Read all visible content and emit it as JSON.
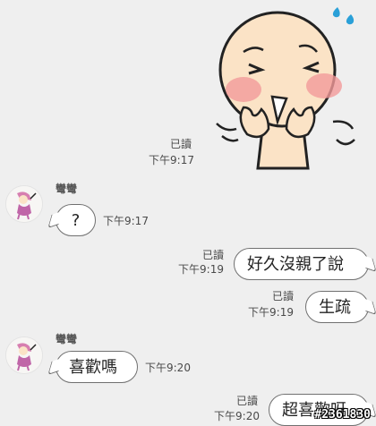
{
  "messages": [
    {
      "id": "m1",
      "side": "out",
      "type": "sticker",
      "read": "已讀",
      "time": "下午9:17",
      "sticker": "blushing-worried-sticker"
    },
    {
      "id": "m2",
      "side": "in",
      "sender": "彎彎",
      "text": "?",
      "time": "下午9:17"
    },
    {
      "id": "m3",
      "side": "out",
      "text": "好久沒親了說",
      "read": "已讀",
      "time": "下午9:19"
    },
    {
      "id": "m4",
      "side": "out",
      "text": "生疏",
      "read": "已讀",
      "time": "下午9:19"
    },
    {
      "id": "m5",
      "side": "in",
      "sender": "彎彎",
      "text": "喜歡嗎",
      "time": "下午9:20"
    },
    {
      "id": "m6",
      "side": "out",
      "text": "超喜歡呀",
      "read": "已讀",
      "time": "下午9:20"
    }
  ],
  "watermark": "#2361830",
  "colors": {
    "background": "#efefef",
    "bubble": "#ffffff",
    "bubble_border": "#707070",
    "blush": "#f29a9a",
    "sweat": "#2aa0d8"
  }
}
